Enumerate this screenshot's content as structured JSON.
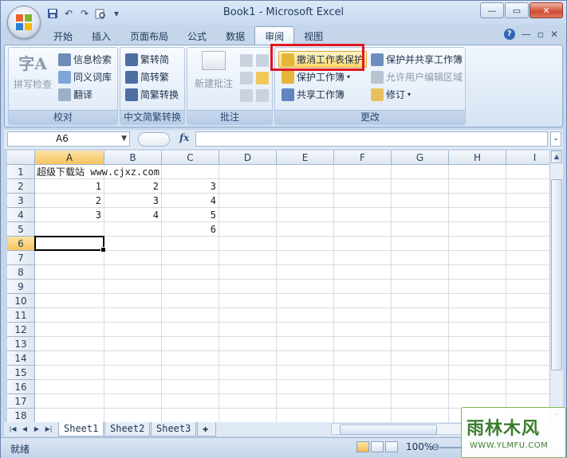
{
  "window": {
    "title": "Book1 - Microsoft Excel"
  },
  "qat": {
    "save": "save-icon",
    "undo": "undo-icon",
    "redo": "redo-icon",
    "print_preview": "print-preview-icon"
  },
  "tabs": [
    "开始",
    "插入",
    "页面布局",
    "公式",
    "数据",
    "审阅",
    "视图"
  ],
  "active_tab": "审阅",
  "ribbon": {
    "proof": {
      "label": "校对",
      "spell": "拼写检查",
      "research": "信息检索",
      "thesaurus": "同义词库",
      "translate": "翻译"
    },
    "chinese": {
      "label": "中文简繁转换",
      "to_trad": "繁转简",
      "to_simp": "简转繁",
      "convert": "简繁转换"
    },
    "comments": {
      "label": "批注",
      "new_comment": "新建批注"
    },
    "changes": {
      "label": "更改",
      "unprotect_sheet": "撤消工作表保护",
      "protect_workbook": "保护工作簿",
      "share_workbook": "共享工作簿",
      "protect_share": "保护并共享工作簿",
      "allow_edit": "允许用户编辑区域",
      "track": "修订"
    }
  },
  "formula_bar": {
    "name_box": "A6",
    "fx": "fx",
    "content": ""
  },
  "columns": [
    "A",
    "B",
    "C",
    "D",
    "E",
    "F",
    "G",
    "H",
    "I"
  ],
  "rows": [
    "1",
    "2",
    "3",
    "4",
    "5",
    "6",
    "7",
    "8",
    "9",
    "10",
    "11",
    "12",
    "13",
    "14",
    "15",
    "16",
    "17",
    "18"
  ],
  "cells": {
    "A1": "超级下载站 www.cjxz.com",
    "A2": "1",
    "B2": "2",
    "C2": "3",
    "A3": "2",
    "B3": "3",
    "C3": "4",
    "A4": "3",
    "B4": "4",
    "C4": "5",
    "C5": "6"
  },
  "active_cell": "A6",
  "sheet_tabs": [
    "Sheet1",
    "Sheet2",
    "Sheet3"
  ],
  "active_sheet": "Sheet1",
  "status": {
    "ready": "就绪",
    "zoom": "100%"
  },
  "watermark": {
    "line1": "雨林木风",
    "line2": "WWW.YLMFU.COM"
  },
  "colors": {
    "highlight": "#e0161f",
    "ribbon_bg": "#d5e3f4",
    "selected_header": "#f7c45f"
  }
}
